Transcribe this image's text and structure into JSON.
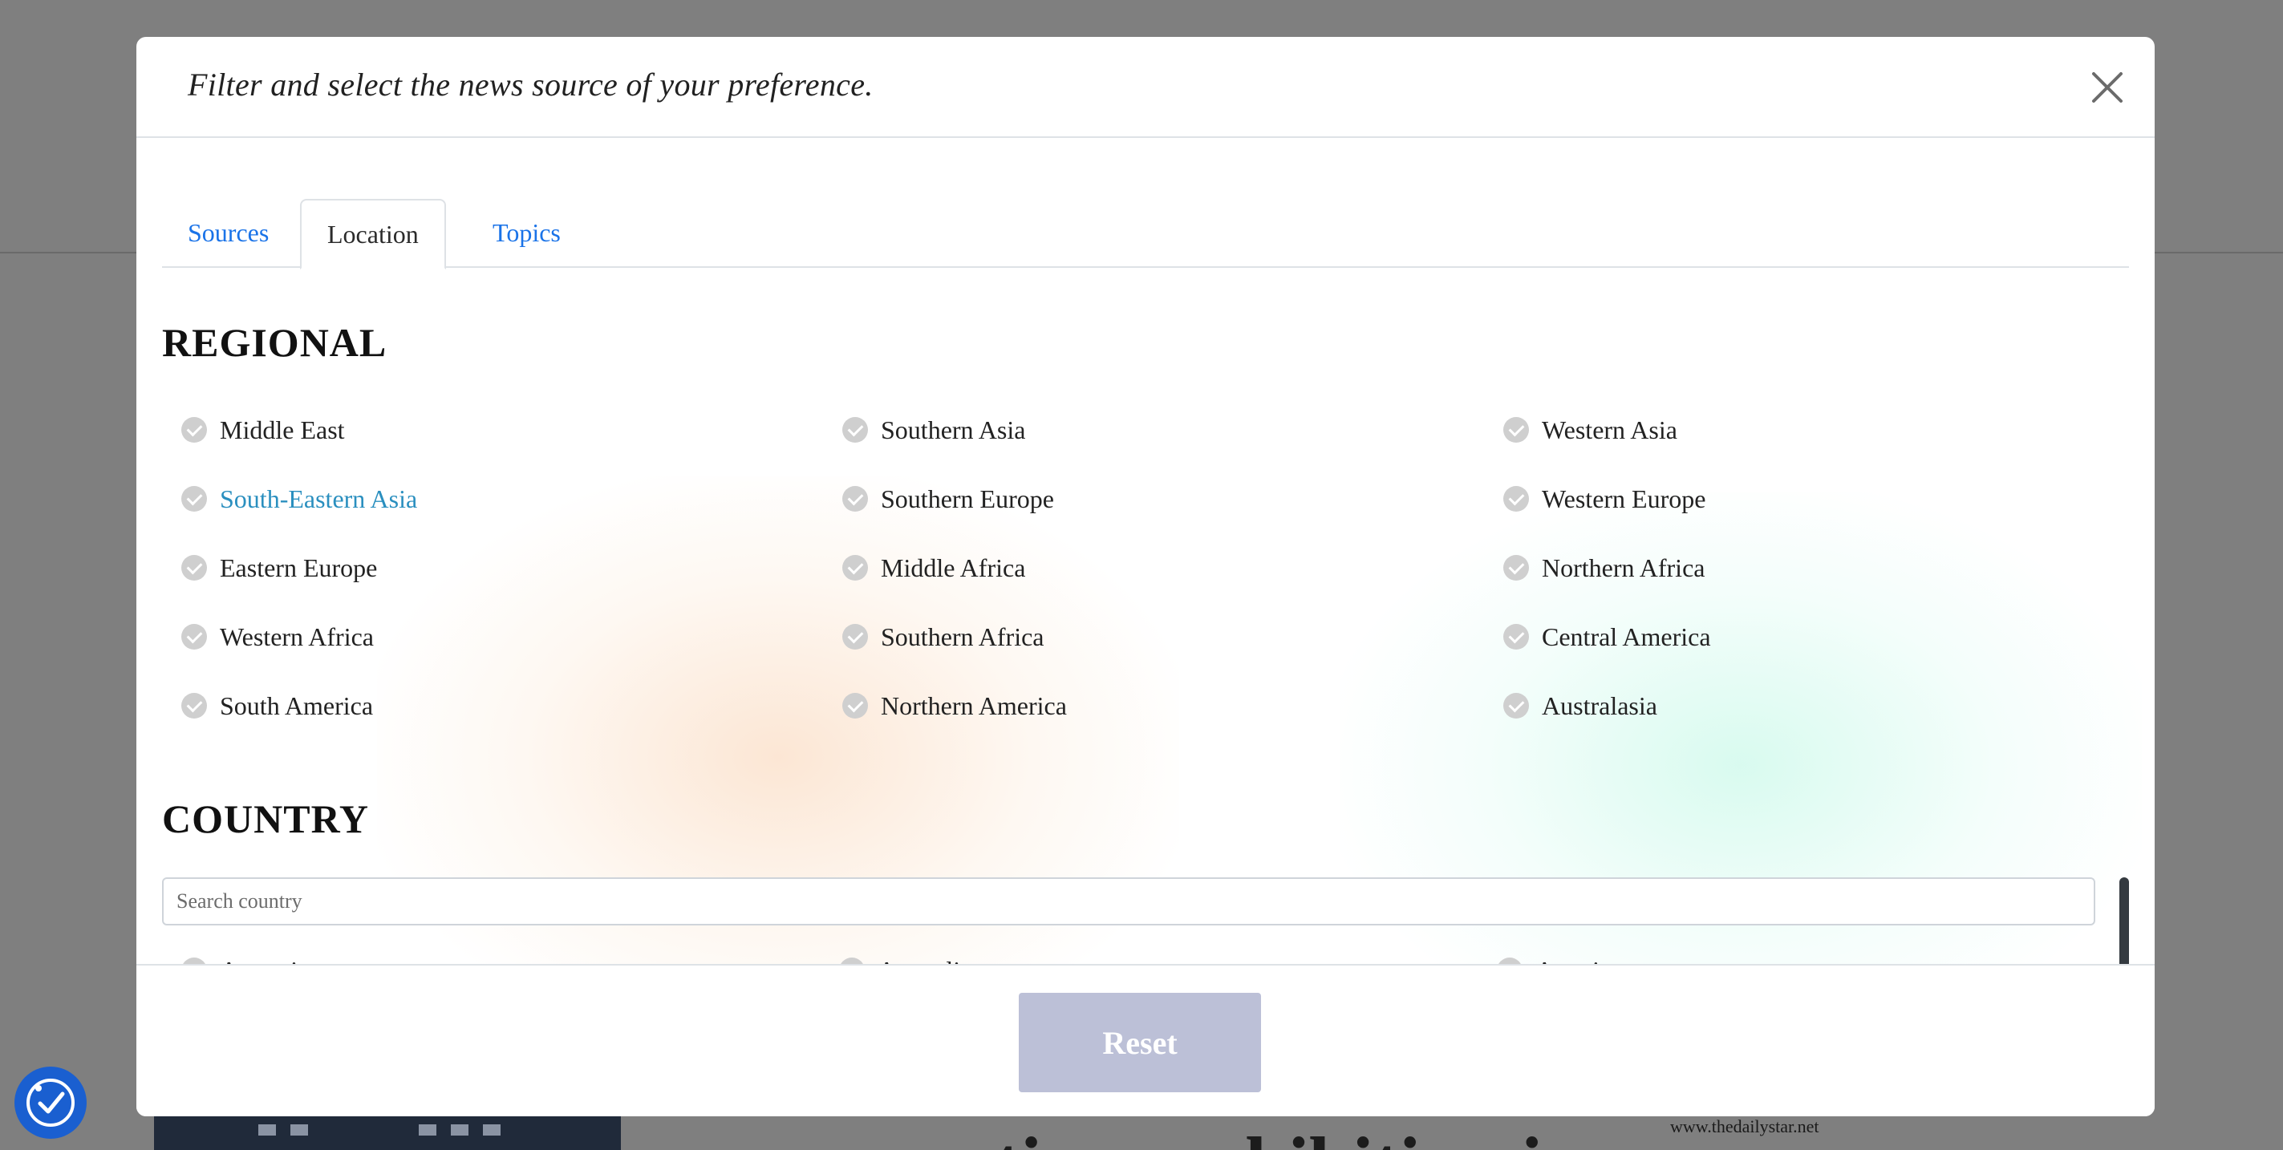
{
  "background": {
    "headline_fragment": "tings exhibition i",
    "domain": "www.thedailystar.net"
  },
  "modal": {
    "title": "Filter and select the news source of your preference.",
    "close_icon": "close-icon"
  },
  "tabs": [
    {
      "label": "Sources",
      "active": false
    },
    {
      "label": "Location",
      "active": true
    },
    {
      "label": "Topics",
      "active": false
    }
  ],
  "regional": {
    "heading": "REGIONAL",
    "items": [
      "Middle East",
      "Southern Asia",
      "Western Asia",
      "South-Eastern Asia",
      "Southern Europe",
      "Western Europe",
      "Eastern Europe",
      "Middle Africa",
      "Northern Africa",
      "Western Africa",
      "Southern Africa",
      "Central America",
      "South America",
      "Northern America",
      "Australasia"
    ],
    "highlighted": "South-Eastern Asia"
  },
  "country": {
    "heading": "COUNTRY",
    "search_placeholder": "Search country",
    "items": [
      "Argentina",
      "Australia",
      "Austria"
    ]
  },
  "footer": {
    "reset_label": "Reset"
  },
  "colors": {
    "tab_link": "#1a73e8",
    "highlight": "#2a8fbf",
    "reset_button": "#bcc0d7",
    "accessibility_button": "#1a5fd0"
  }
}
